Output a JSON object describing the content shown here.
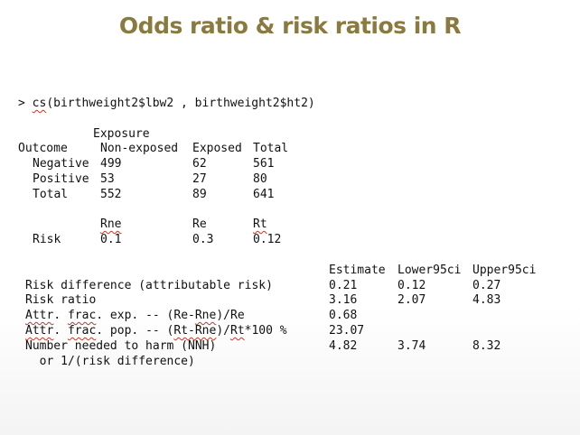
{
  "title": "Odds ratio & risk ratios in R",
  "command": {
    "prompt": ">",
    "fn": "cs",
    "args": "(birthweight2$lbw2 , birthweight2$ht2)"
  },
  "table": {
    "header_group": "Exposure",
    "col_labels": [
      "Outcome",
      "Non-exposed",
      "Exposed",
      "Total"
    ],
    "rows": [
      {
        "label": "Negative",
        "values": [
          "499",
          "62",
          "561"
        ]
      },
      {
        "label": "Positive",
        "values": [
          "53",
          "27",
          "80"
        ]
      },
      {
        "label": "Total",
        "values": [
          "552",
          "89",
          "641"
        ]
      }
    ]
  },
  "risk": {
    "headers": [
      "Rne",
      "Re",
      "Rt"
    ],
    "label": "Risk",
    "values": [
      "0.1",
      "0.3",
      "0.12"
    ]
  },
  "estimates": {
    "headers": [
      "Estimate",
      "Lower95ci",
      "Upper95ci"
    ],
    "rows": [
      {
        "label": "Risk difference (attributable risk)",
        "values": [
          "0.21",
          "0.12",
          "0.27"
        ]
      },
      {
        "label": "Risk ratio",
        "values": [
          "3.16",
          "2.07",
          "4.83"
        ]
      },
      {
        "label_parts": [
          "Attr",
          ". ",
          "frac",
          ". exp. -- (Re-",
          "Rne",
          ")/Re"
        ],
        "values": [
          "0.68",
          "",
          ""
        ]
      },
      {
        "label_parts": [
          "Attr",
          ". ",
          "frac",
          ". pop. -- (",
          "Rt-Rne",
          ")/",
          "Rt",
          "*100 %"
        ],
        "values": [
          "23.07",
          "",
          ""
        ]
      },
      {
        "label": "Number needed to harm (NNH)",
        "values": [
          "4.82",
          "3.74",
          "8.32"
        ]
      },
      {
        "label": "  or 1/(risk difference)",
        "values": [
          "",
          "",
          ""
        ]
      }
    ]
  }
}
